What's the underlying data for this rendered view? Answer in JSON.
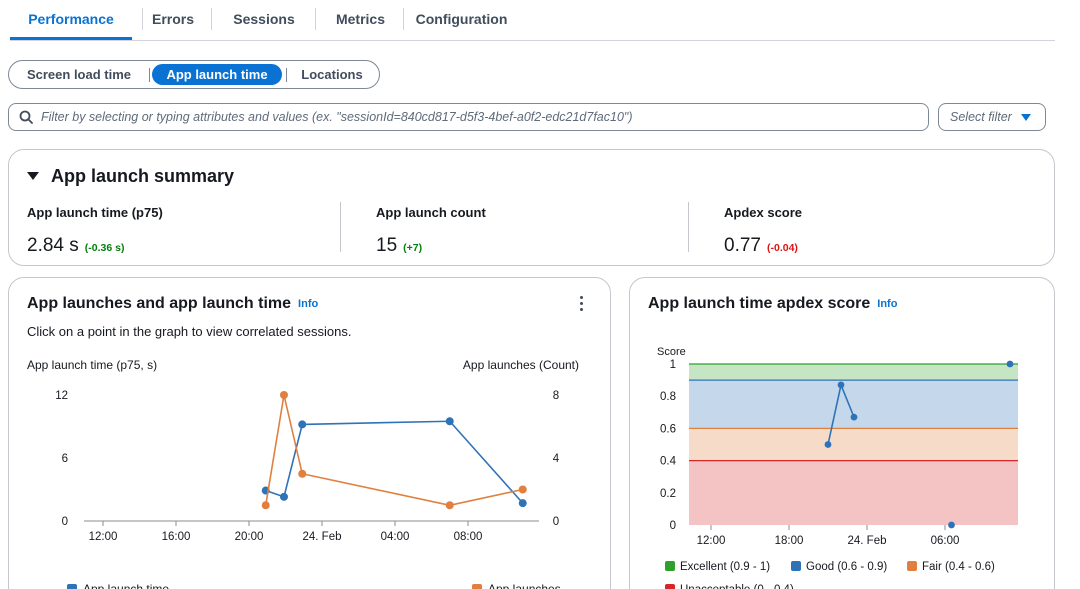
{
  "tabs": [
    "Performance",
    "Errors",
    "Sessions",
    "Metrics",
    "Configuration"
  ],
  "active_tab": "Performance",
  "segments": [
    "Screen load time",
    "App launch time",
    "Locations"
  ],
  "active_segment": "App launch time",
  "filter": {
    "placeholder": "Filter by selecting or typing attributes and values (ex. \"sessionId=840cd817-d5f3-4bef-a0f2-edc21d7fac10\")",
    "select_label": "Select filter"
  },
  "summary": {
    "title": "App launch summary",
    "kpis": [
      {
        "label": "App launch time (p75)",
        "value": "2.84 s",
        "delta": "(-0.36 s)",
        "trend": "good"
      },
      {
        "label": "App launch count",
        "value": "15",
        "delta": "(+7)",
        "trend": "good"
      },
      {
        "label": "Apdex score",
        "value": "0.77",
        "delta": "(-0.04)",
        "trend": "bad"
      }
    ]
  },
  "chart1": {
    "title": "App launches and app launch time",
    "info": "Info",
    "subtitle": "Click on a point in the graph to view correlated sessions.",
    "left_axis_label": "App launch time (p75, s)",
    "right_axis_label": "App launches (Count)",
    "legend": [
      "App launch time",
      "App launches"
    ]
  },
  "chart2": {
    "title": "App launch time apdex score",
    "info": "Info",
    "y_axis_label": "Score",
    "legend": [
      "Excellent (0.9 - 1)",
      "Good (0.6 - 0.9)",
      "Fair (0.4 - 0.6)",
      "Unacceptable (0 - 0.4)"
    ]
  },
  "chart_data": [
    {
      "type": "line",
      "title": "App launches and app launch time",
      "x_ticks": [
        "12:00",
        "16:00",
        "20:00",
        "24. Feb",
        "04:00",
        "08:00"
      ],
      "y_left": {
        "label": "App launch time (p75, s)",
        "ticks": [
          0,
          6,
          12
        ],
        "ylim": [
          0,
          12
        ]
      },
      "y_right": {
        "label": "App launches (Count)",
        "ticks": [
          0,
          4,
          8
        ],
        "ylim": [
          0,
          8
        ]
      },
      "series": [
        {
          "name": "App launch time",
          "axis": "left",
          "color": "#2e73b8",
          "x": [
            "20:55",
            "21:55",
            "22:55",
            "07:00",
            "11:00"
          ],
          "values": [
            2.9,
            2.3,
            9.2,
            9.5,
            1.7
          ]
        },
        {
          "name": "App launches",
          "axis": "right",
          "color": "#e07f3e",
          "x": [
            "20:55",
            "21:55",
            "22:55",
            "07:00",
            "11:00"
          ],
          "values": [
            1,
            8,
            3,
            1,
            2
          ]
        }
      ],
      "legend_position": "bottom"
    },
    {
      "type": "line",
      "title": "App launch time apdex score",
      "y_label": "Score",
      "x_ticks": [
        "12:00",
        "18:00",
        "24. Feb",
        "06:00"
      ],
      "y_ticks": [
        0,
        0.2,
        0.4,
        0.6,
        0.8,
        1
      ],
      "ylim": [
        0,
        1
      ],
      "bands": [
        {
          "name": "Excellent (0.9 - 1)",
          "from": 0.9,
          "to": 1,
          "color": "#2ea02c"
        },
        {
          "name": "Good (0.6 - 0.9)",
          "from": 0.6,
          "to": 0.9,
          "color": "#2e73b8"
        },
        {
          "name": "Fair (0.4 - 0.6)",
          "from": 0.4,
          "to": 0.6,
          "color": "#e07f3e"
        },
        {
          "name": "Unacceptable (0 - 0.4)",
          "from": 0,
          "to": 0.4,
          "color": "#d62728"
        }
      ],
      "series": [
        {
          "x": [
            "21:00",
            "22:00",
            "23:00"
          ],
          "values": [
            0.5,
            0.87,
            0.67
          ],
          "color": "#2e73b8",
          "connected": true
        },
        {
          "x": [
            "06:30"
          ],
          "values": [
            0.0
          ],
          "color": "#2e73b8",
          "connected": false
        },
        {
          "x": [
            "11:00"
          ],
          "values": [
            1.0
          ],
          "color": "#2e73b8",
          "connected": false
        }
      ],
      "legend_position": "bottom"
    }
  ]
}
